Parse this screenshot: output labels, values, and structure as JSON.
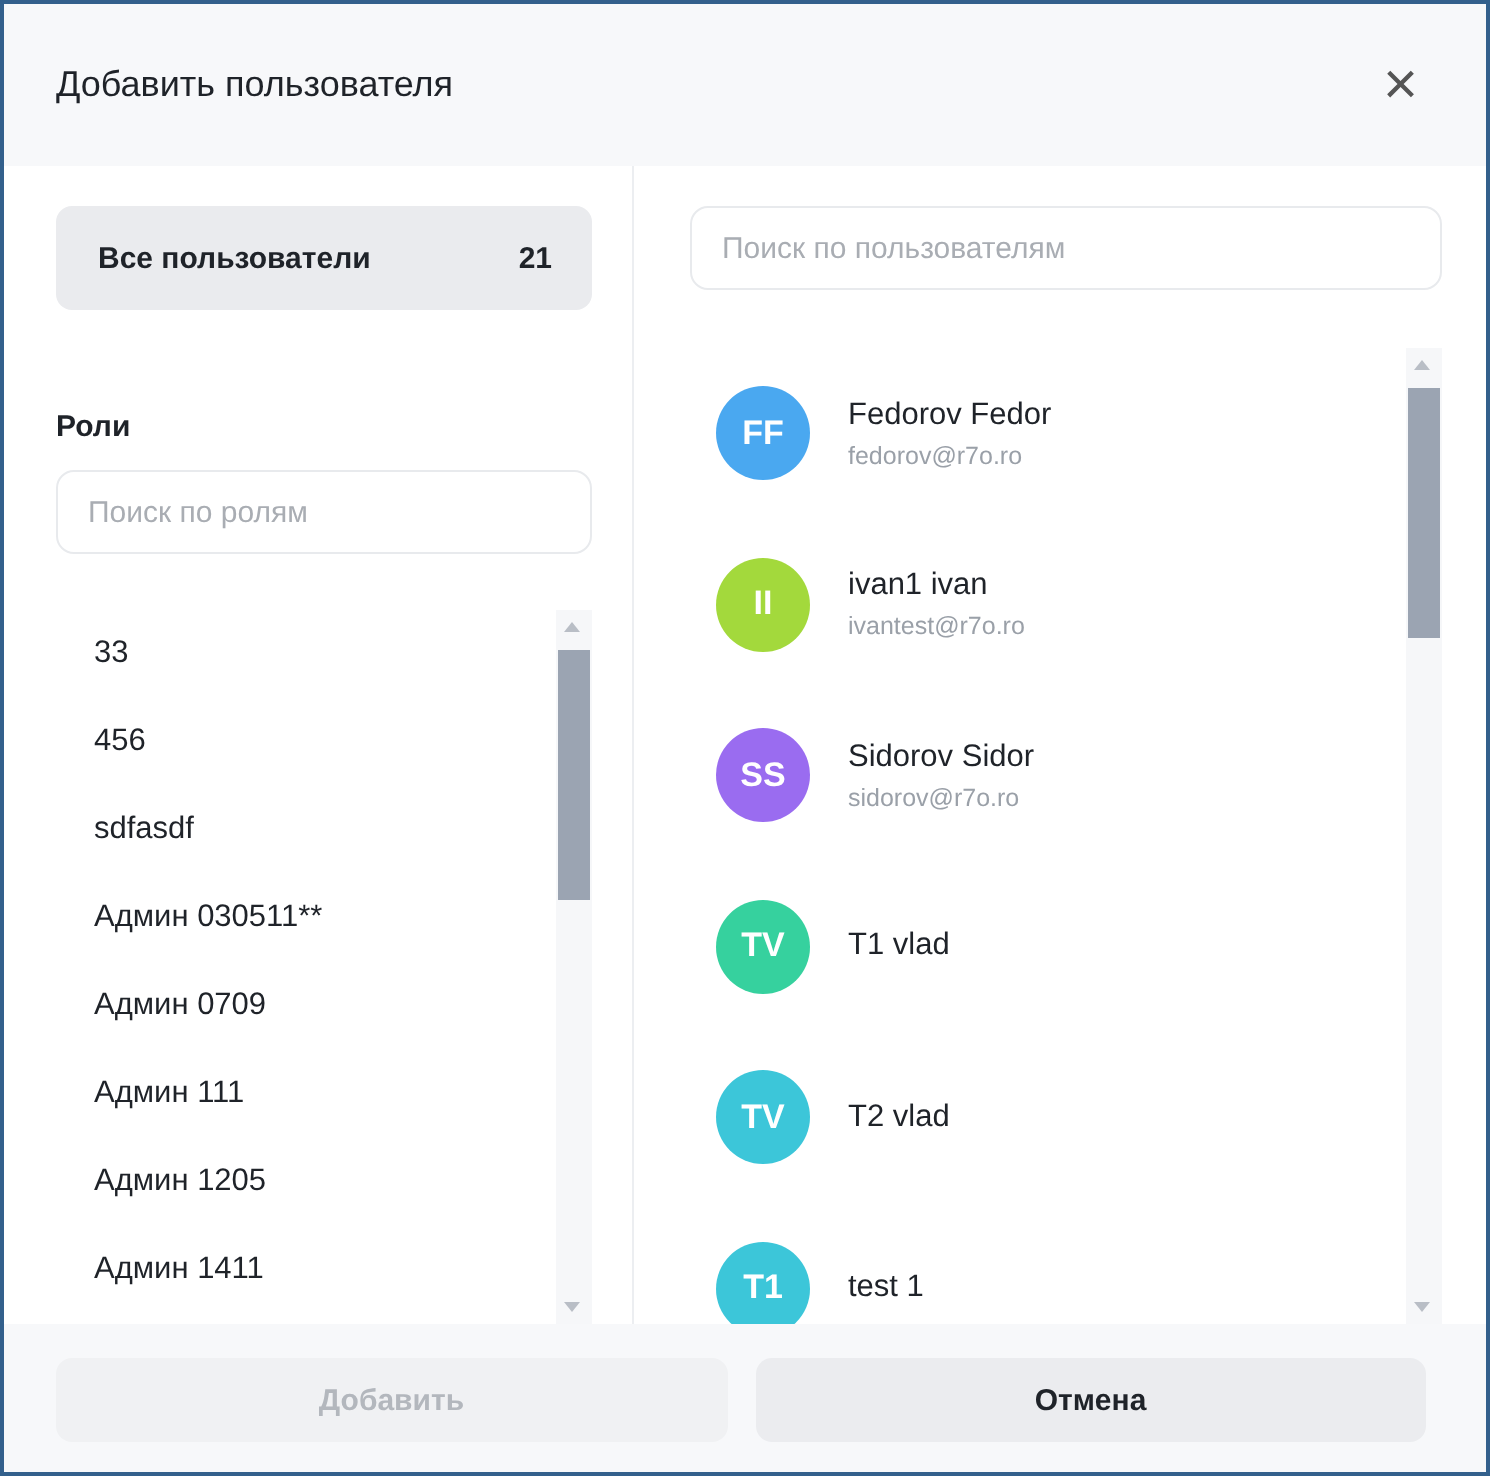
{
  "dialog": {
    "title": "Добавить пользователя",
    "close": "×"
  },
  "all_users": {
    "label": "Все пользователи",
    "count": "21",
    "selected": true
  },
  "roles": {
    "heading": "Роли",
    "search": {
      "placeholder": "Поиск по ролям"
    },
    "items": [
      "33",
      "456",
      "sdfasdf",
      "Админ 030511**",
      "Админ 0709",
      "Админ 111",
      "Админ 1205",
      "Админ 1411"
    ]
  },
  "users": {
    "search": {
      "placeholder": "Поиск по пользователям"
    },
    "items": [
      {
        "initials": "FF",
        "name": "Fedorov Fedor",
        "email": "fedorov@r7o.ro",
        "color": "#4aa8f0"
      },
      {
        "initials": "II",
        "name": "ivan1 ivan",
        "email": "ivantest@r7o.ro",
        "color": "#a3d93c"
      },
      {
        "initials": "SS",
        "name": "Sidorov Sidor",
        "email": "sidorov@r7o.ro",
        "color": "#9a6cf0"
      },
      {
        "initials": "TV",
        "name": "T1 vlad",
        "color": "#36d19e"
      },
      {
        "initials": "TV",
        "name": "T2 vlad",
        "color": "#3cc6d9"
      },
      {
        "initials": "T1",
        "name": "test 1",
        "color": "#3cc6d9"
      }
    ]
  },
  "buttons": [
    {
      "label": "Добавить",
      "disabled": true
    },
    {
      "label": "Отмена",
      "disabled": false
    }
  ]
}
